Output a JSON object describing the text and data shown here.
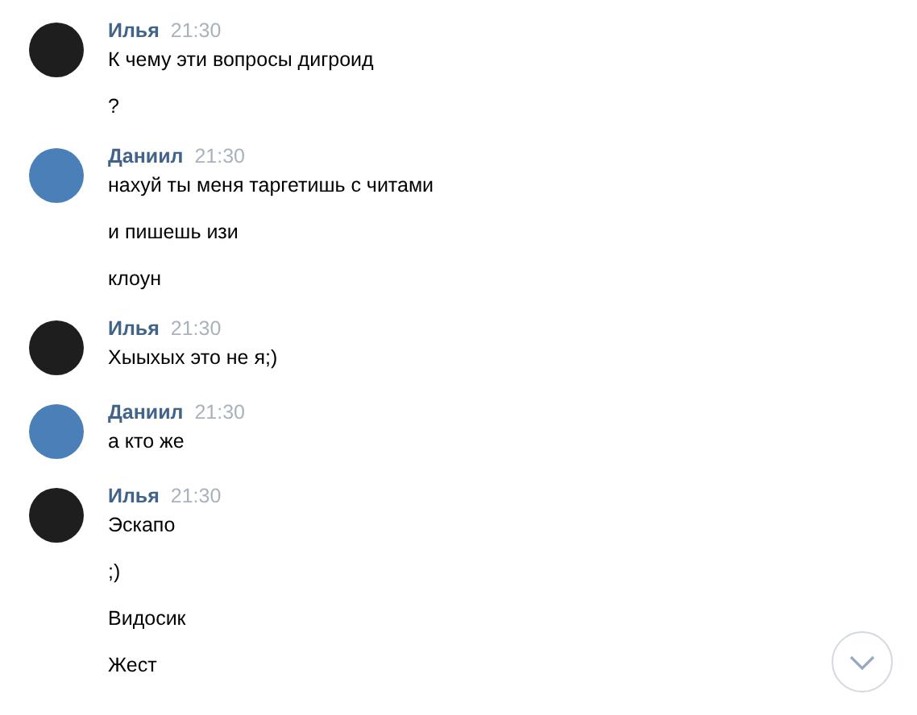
{
  "messages": [
    {
      "author": "Илья",
      "time": "21:30",
      "color": "#1e1e1e",
      "lines": [
        "К чему эти вопросы дигроид",
        "?"
      ]
    },
    {
      "author": "Даниил",
      "time": "21:30",
      "color": "#4a7fb8",
      "lines": [
        "нахуй ты меня таргетишь с читами",
        "и пишешь изи",
        "клоун"
      ]
    },
    {
      "author": "Илья",
      "time": "21:30",
      "color": "#1e1e1e",
      "lines": [
        "Хыыхых это не я;)"
      ]
    },
    {
      "author": "Даниил",
      "time": "21:30",
      "color": "#4a7fb8",
      "lines": [
        "а кто же"
      ]
    },
    {
      "author": "Илья",
      "time": "21:30",
      "color": "#1e1e1e",
      "lines": [
        "Эскапо",
        ";)",
        "Видосик",
        "Жест"
      ]
    }
  ],
  "scroll_down_button": true
}
